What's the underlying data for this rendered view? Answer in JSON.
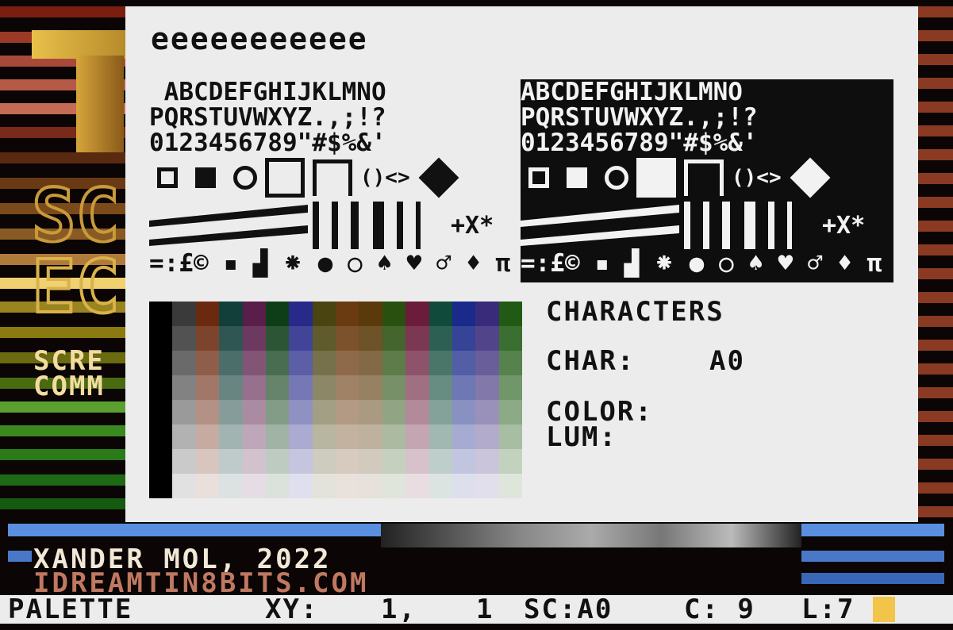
{
  "panel": {
    "header": "eeeeeeeeeee",
    "charset_rows": [
      " ABCDEFGHIJKLMNO",
      "PQRSTUVWXYZ.,;!?",
      "0123456789\"#$%&'",
      "=:£©"
    ],
    "charset_inverse_rows": [
      "ABCDEFGHIJKLMNO",
      "PQRSTUVWXYZ.,;!?",
      "0123456789\"#$%&'",
      "=:£©"
    ],
    "info": {
      "mode_label": "CHARACTERS",
      "char_label": "CHAR:",
      "char_value": "A0",
      "color_label": "COLOR:",
      "lum_label": "LUM:"
    },
    "palette_colors": [
      "#000000",
      "#3a3a3a",
      "#6b2a10",
      "#123f3a",
      "#5a1e4a",
      "#0e3e18",
      "#282a8a",
      "#4a4410",
      "#6a3a10",
      "#5a3a0a",
      "#2a5010",
      "#6a1c3a",
      "#104a3a",
      "#1a2a8a",
      "#3a2a7a",
      "#205a14"
    ]
  },
  "bottom": {
    "credit_line": "XANDER MOL, 2022",
    "website": "IDREAMTIN8BITS.COM"
  },
  "status_bar": {
    "mode": "PALETTE",
    "xy_label": "XY:",
    "x": "1,",
    "y": "1",
    "sc": "SC:A0",
    "c": "C: 9",
    "l": "L:7"
  },
  "logo": {
    "big_letter": "T",
    "line1": "SC",
    "line2": "EC",
    "small1": "SCRE",
    "small2": "COMM"
  }
}
